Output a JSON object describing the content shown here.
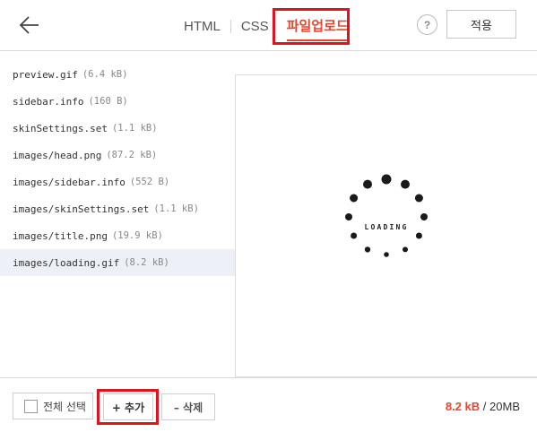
{
  "header": {
    "back_icon": "arrow-left-icon",
    "tabs": [
      {
        "label": "HTML"
      },
      {
        "label": "CSS"
      },
      {
        "label": "파일업로드"
      }
    ],
    "active_tab": "파일업로드",
    "help_label": "?",
    "apply_label": "적용"
  },
  "files": [
    {
      "name": "preview.gif",
      "size": "(6.4 kB)"
    },
    {
      "name": "sidebar.info",
      "size": "(160 B)"
    },
    {
      "name": "skinSettings.set",
      "size": "(1.1 kB)"
    },
    {
      "name": "images/head.png",
      "size": "(87.2 kB)"
    },
    {
      "name": "images/sidebar.info",
      "size": "(552 B)"
    },
    {
      "name": "images/skinSettings.set",
      "size": "(1.1 kB)"
    },
    {
      "name": "images/title.png",
      "size": "(19.9 kB)"
    },
    {
      "name": "images/loading.gif",
      "size": "(8.2 kB)"
    }
  ],
  "selected_file_index": 7,
  "preview": {
    "loading_text": "LOADING"
  },
  "footer": {
    "select_all_label": "전체 선택",
    "add_label": "+ 추가",
    "delete_label": "– 삭제",
    "usage_used": "8.2 kB",
    "usage_sep": " / ",
    "usage_total": "20MB"
  },
  "colors": {
    "accent": "#e8452c",
    "highlight_box": "#e0141e",
    "selected_row": "#eef0f8"
  }
}
